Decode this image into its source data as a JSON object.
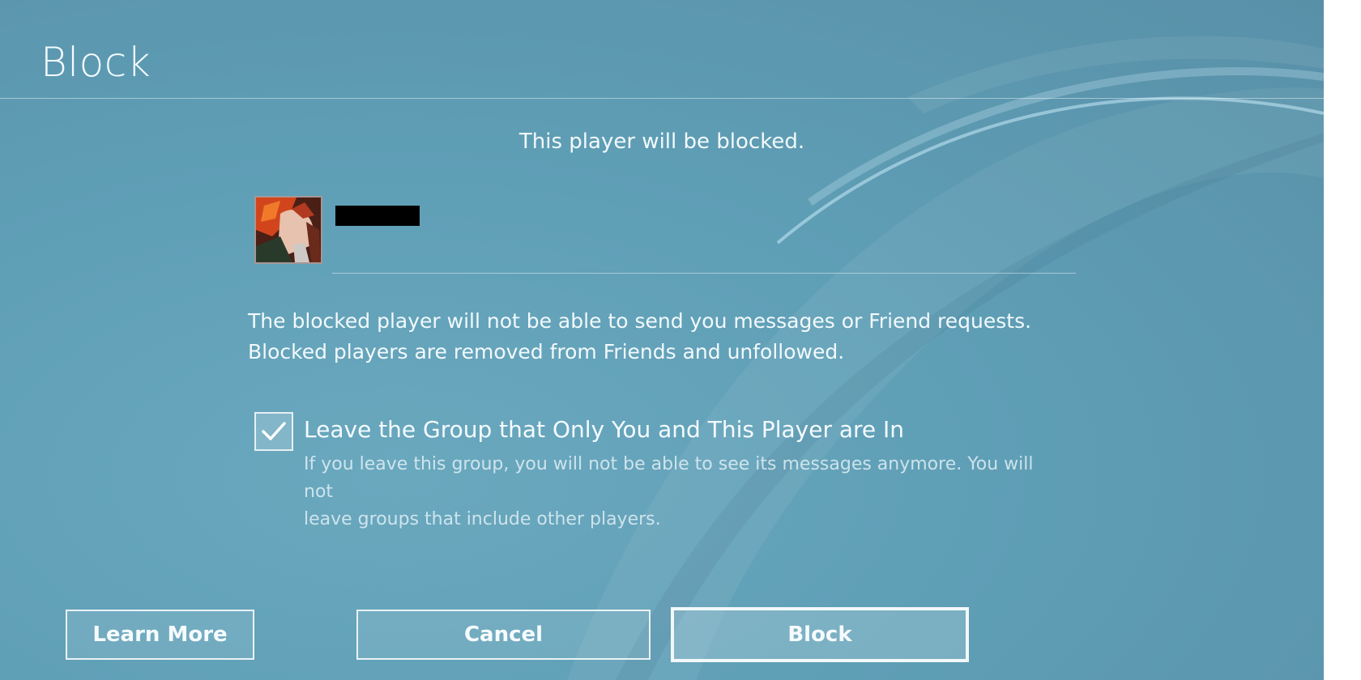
{
  "dialog": {
    "title": "Block",
    "headline": "This player will be blocked."
  },
  "player": {
    "avatar_icon": "player-avatar-image",
    "name": ""
  },
  "description": {
    "line1": "The blocked player will not be able to send you messages or Friend requests.",
    "line2": "Blocked players are removed from Friends and unfollowed."
  },
  "leave_group_option": {
    "checked": true,
    "label": "Leave the Group that Only You and This Player are In",
    "detail_line1": "If you leave this group, you will not be able to see its messages anymore. You will not",
    "detail_line2": "leave groups that include other players."
  },
  "buttons": {
    "learn_more": "Learn More",
    "cancel": "Cancel",
    "block": "Block"
  },
  "colors": {
    "background": "#5f9fb6",
    "text": "#f2f9fc",
    "focus_border": "#f3f8fa"
  }
}
